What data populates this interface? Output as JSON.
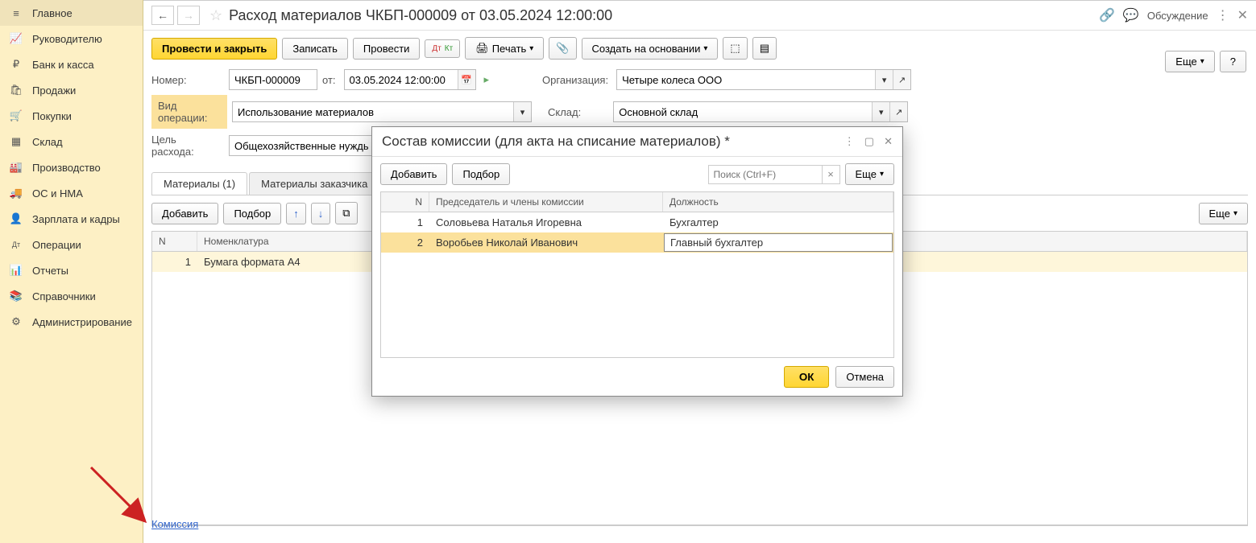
{
  "sidebar": {
    "items": [
      {
        "label": "Главное",
        "icon": "≡"
      },
      {
        "label": "Руководителю",
        "icon": "📈"
      },
      {
        "label": "Банк и касса",
        "icon": "₽"
      },
      {
        "label": "Продажи",
        "icon": "🛍"
      },
      {
        "label": "Покупки",
        "icon": "🛒"
      },
      {
        "label": "Склад",
        "icon": "▦"
      },
      {
        "label": "Производство",
        "icon": "🏭"
      },
      {
        "label": "ОС и НМА",
        "icon": "🚚"
      },
      {
        "label": "Зарплата и кадры",
        "icon": "👤"
      },
      {
        "label": "Операции",
        "icon": "Дт"
      },
      {
        "label": "Отчеты",
        "icon": "📊"
      },
      {
        "label": "Справочники",
        "icon": "📚"
      },
      {
        "label": "Администрирование",
        "icon": "⚙"
      }
    ]
  },
  "title": "Расход материалов ЧКБП-000009 от 03.05.2024 12:00:00",
  "discussion": "Обсуждение",
  "toolbar": {
    "post_close": "Провести и закрыть",
    "save": "Записать",
    "post": "Провести",
    "print": "Печать",
    "create_based": "Создать на основании",
    "more": "Еще",
    "help": "?"
  },
  "form": {
    "number_label": "Номер:",
    "number": "ЧКБП-000009",
    "from_label": "от:",
    "date": "03.05.2024 12:00:00",
    "org_label": "Организация:",
    "org": "Четыре колеса ООО",
    "optype_label": "Вид операции:",
    "optype": "Использование материалов",
    "warehouse_label": "Склад:",
    "warehouse": "Основной склад",
    "purpose_label": "Цель расхода:",
    "purpose": "Общехозяйственные нужды о"
  },
  "tabs": {
    "materials": "Материалы (1)",
    "customer_materials": "Материалы заказчика"
  },
  "mat_toolbar": {
    "add": "Добавить",
    "pick": "Подбор",
    "more": "Еще"
  },
  "mat_table": {
    "col_n": "N",
    "col_name": "Номенклатура",
    "rows": [
      {
        "n": "1",
        "name": "Бумага формата А4"
      }
    ]
  },
  "dialog": {
    "title": "Состав комиссии (для акта на списание материалов) *",
    "add": "Добавить",
    "pick": "Подбор",
    "search_placeholder": "Поиск (Ctrl+F)",
    "more": "Еще",
    "col_n": "N",
    "col_member": "Председатель и члены комиссии",
    "col_position": "Должность",
    "rows": [
      {
        "n": "1",
        "name": "Соловьева Наталья Игоревна",
        "position": "Бухгалтер"
      },
      {
        "n": "2",
        "name": "Воробьев Николай Иванович",
        "position": "Главный бухгалтер"
      }
    ],
    "ok": "ОК",
    "cancel": "Отмена"
  },
  "bottom_link": "Комиссия"
}
